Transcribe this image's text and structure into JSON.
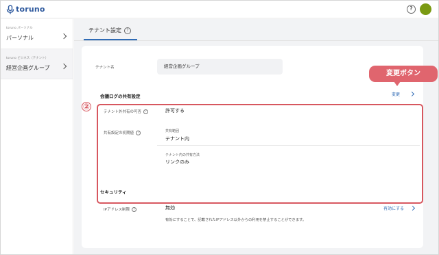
{
  "app": {
    "logo_text": "toruno"
  },
  "header": {
    "help_icon": "question-circle-icon",
    "avatar_color": "#7a9a12"
  },
  "sidebar": {
    "sections": [
      {
        "caption": "toruno パーソナル",
        "item": "パーソナル"
      },
      {
        "caption": "toruno ビジネス（テナント）",
        "item": "経営企画グループ"
      }
    ]
  },
  "main": {
    "tab_label": "テナント設定",
    "tenant": {
      "label": "テナント名",
      "value": "経営企画グループ"
    },
    "log_share": {
      "title": "会議ログの共有設定",
      "change_label": "変更",
      "external_label": "テナント外共有の可否",
      "external_value": "許可する",
      "initial_label": "共有設定の初期値",
      "range_caption": "共有範囲",
      "range_value": "テナント内",
      "method_caption": "テナント内の共有方法",
      "method_value": "リンクのみ"
    },
    "security": {
      "title": "セキュリティ",
      "ip_label": "IPアドレス制限",
      "ip_value": "無効",
      "ip_link": "有効にする",
      "ip_desc": "有効にすることで、記載されたIPアドレス以外からの利用を禁止することができます。"
    }
  },
  "annotations": {
    "number": "②",
    "callout": "変更ボタン",
    "highlight_color": "#d7575f"
  },
  "colors": {
    "accent": "#2f6bb5",
    "brand": "#2f5a9e"
  }
}
